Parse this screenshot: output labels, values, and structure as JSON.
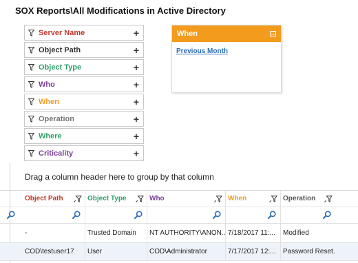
{
  "page": {
    "title": "SOX Reports\\All Modifications in  Active Directory"
  },
  "filters": [
    {
      "label": "Server Name",
      "color": "#c0392b"
    },
    {
      "label": "Object Path",
      "color": "#333333"
    },
    {
      "label": "Object Type",
      "color": "#2e9e6b"
    },
    {
      "label": "Who",
      "color": "#7b3f98"
    },
    {
      "label": "When",
      "color": "#f29b1d"
    },
    {
      "label": "Operation",
      "color": "#777777"
    },
    {
      "label": "Where",
      "color": "#2e9e6b"
    },
    {
      "label": "Criticality",
      "color": "#7b3f98"
    }
  ],
  "filter_add_symbol": "+",
  "when_panel": {
    "title": "When",
    "link": "Previous Month"
  },
  "grid": {
    "group_hint": "Drag a column header here to group by that column",
    "columns": [
      {
        "label": "Object Path",
        "color": "#c0392b"
      },
      {
        "label": "Object Type",
        "color": "#2e9e6b"
      },
      {
        "label": "Who",
        "color": "#7b3f98"
      },
      {
        "label": "When",
        "color": "#f29b1d"
      },
      {
        "label": "Operation",
        "color": "#555555"
      }
    ],
    "rows": [
      [
        "-",
        "Trusted Domain",
        "NT AUTHORITY\\ANON...",
        "7/18/2017 11:...",
        "Modified"
      ],
      [
        "COD\\testuser17",
        "User",
        "COD\\Administrator",
        "7/17/2017 12:...",
        "Password Reset..."
      ]
    ]
  }
}
